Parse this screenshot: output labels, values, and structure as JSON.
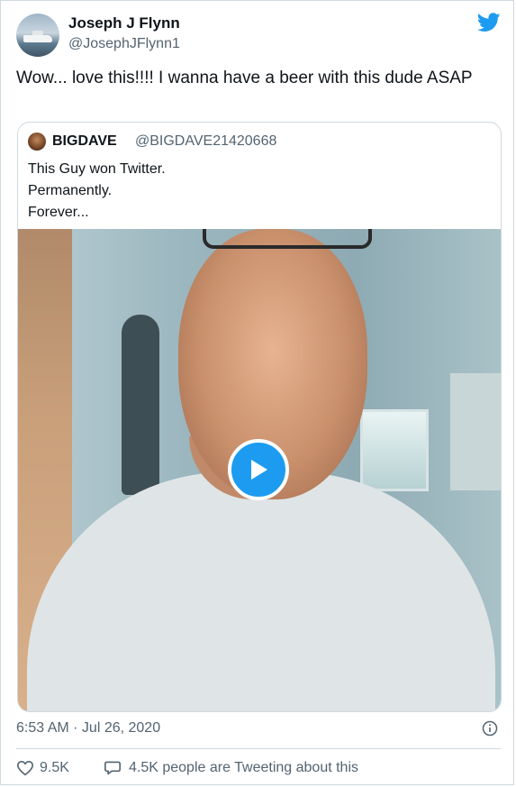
{
  "author": {
    "name": "Joseph J Flynn",
    "handle": "@JosephJFlynn1"
  },
  "tweet": {
    "text": "Wow... love this!!!!   I wanna have a beer with this dude ASAP",
    "timestamp": "6:53 AM · Jul 26, 2020",
    "like_count": "9.5K",
    "tweeting_text": "4.5K people are Tweeting about this"
  },
  "quoted_tweet": {
    "name": "BIGDAVE",
    "handle": "@BIGDAVE21420668",
    "lines": [
      "This Guy won Twitter.",
      "Permanently.",
      "Forever..."
    ]
  },
  "colors": {
    "accent": "#1d9bf0",
    "text": "#0f1419",
    "muted": "#536471",
    "border": "#cfd9de"
  },
  "icons": {
    "brand": "twitter-bird-icon",
    "play": "play-icon",
    "info": "info-icon",
    "like": "heart-icon",
    "reply": "speech-bubble-icon"
  }
}
